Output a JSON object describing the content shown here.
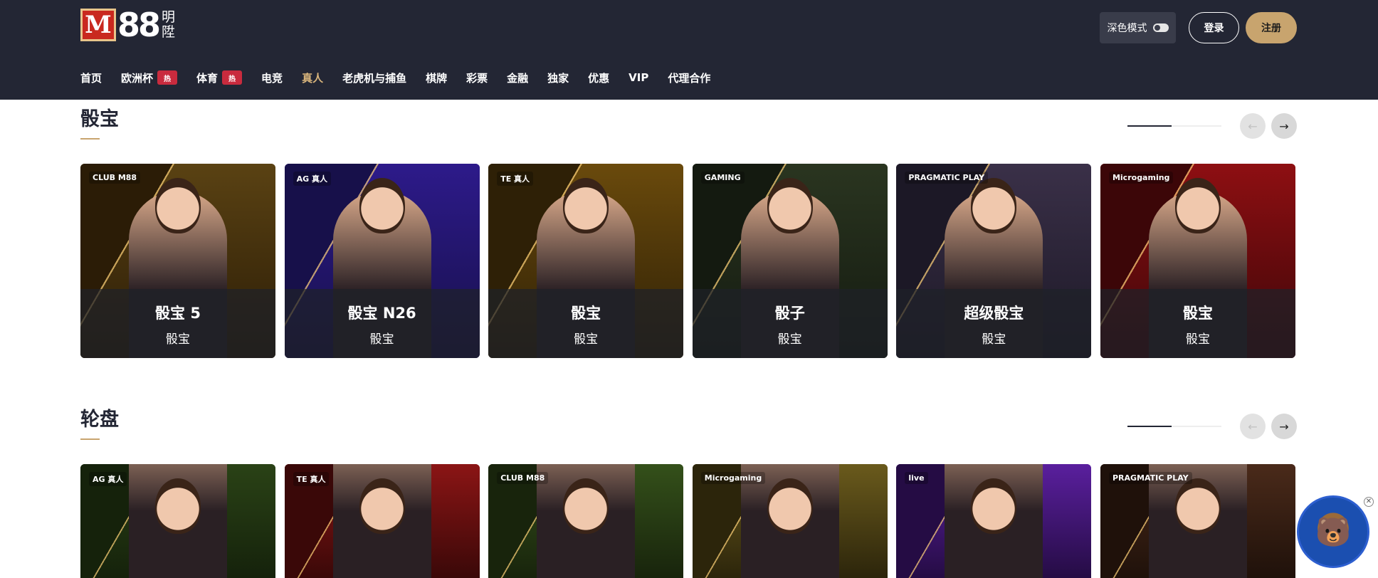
{
  "header": {
    "logo_mark": "M",
    "logo_number": "88",
    "logo_sub_1": "明",
    "logo_sub_2": "陞",
    "dark_mode_label": "深色模式",
    "login_label": "登录",
    "register_label": "注册"
  },
  "nav": [
    {
      "label": "首页",
      "hot": ""
    },
    {
      "label": "欧洲杯",
      "hot": "热"
    },
    {
      "label": "体育",
      "hot": "热"
    },
    {
      "label": "电竞",
      "hot": ""
    },
    {
      "label": "真人",
      "hot": "",
      "active": true
    },
    {
      "label": "老虎机与捕鱼",
      "hot": ""
    },
    {
      "label": "棋牌",
      "hot": ""
    },
    {
      "label": "彩票",
      "hot": ""
    },
    {
      "label": "金融",
      "hot": ""
    },
    {
      "label": "独家",
      "hot": ""
    },
    {
      "label": "优惠",
      "hot": ""
    },
    {
      "label": "VIP",
      "hot": ""
    },
    {
      "label": "代理合作",
      "hot": ""
    }
  ],
  "sections": [
    {
      "title": "骰宝",
      "progress": 0.47,
      "cards": [
        {
          "name": "骰宝 5",
          "type": "骰宝",
          "provider": "CLUB M88",
          "color": "#5a4213",
          "accent": "#2b1c06"
        },
        {
          "name": "骰宝 N26",
          "type": "骰宝",
          "provider": "AG 真人",
          "color": "#2d1a8a",
          "accent": "#17104a"
        },
        {
          "name": "骰宝",
          "type": "骰宝",
          "provider": "TE 真人",
          "color": "#6a4a0c",
          "accent": "#2e2006"
        },
        {
          "name": "骰子",
          "type": "骰宝",
          "provider": "GAMING",
          "color": "#2a3520",
          "accent": "#141a10"
        },
        {
          "name": "超级骰宝",
          "type": "骰宝",
          "provider": "PRAGMATIC PLAY",
          "color": "#3a3048",
          "accent": "#1c1826"
        },
        {
          "name": "骰宝",
          "type": "骰宝",
          "provider": "Microgaming",
          "color": "#8e0f12",
          "accent": "#3c0608"
        }
      ]
    },
    {
      "title": "轮盘",
      "progress": 0.47,
      "cards": [
        {
          "name": "",
          "type": "",
          "provider": "AG 真人",
          "color": "#2a4216",
          "accent": "#15220b"
        },
        {
          "name": "",
          "type": "",
          "provider": "TE 真人",
          "color": "#8b1515",
          "accent": "#3a0808"
        },
        {
          "name": "",
          "type": "",
          "provider": "CLUB M88",
          "color": "#34501a",
          "accent": "#18240c"
        },
        {
          "name": "",
          "type": "",
          "provider": "Microgaming",
          "color": "#6a5a1c",
          "accent": "#2c250b"
        },
        {
          "name": "",
          "type": "",
          "provider": "live",
          "color": "#5a1f9e",
          "accent": "#250c44"
        },
        {
          "name": "",
          "type": "",
          "provider": "PRAGMATIC PLAY",
          "color": "#4a2a1a",
          "accent": "#1f110a"
        }
      ]
    }
  ],
  "icons": {
    "prev": "arrow-left-icon",
    "next": "arrow-right-icon",
    "close": "close-icon"
  }
}
